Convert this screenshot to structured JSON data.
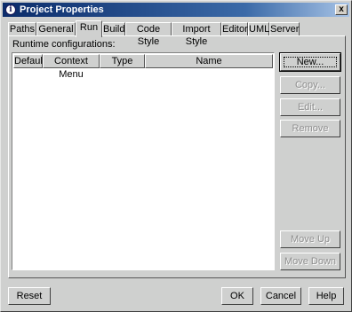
{
  "window": {
    "title": "Project Properties",
    "close_label": "x"
  },
  "tabs": [
    {
      "label": "Paths"
    },
    {
      "label": "General"
    },
    {
      "label": "Run",
      "active": true
    },
    {
      "label": "Build"
    },
    {
      "label": "Code Style"
    },
    {
      "label": "Import Style"
    },
    {
      "label": "Editor"
    },
    {
      "label": "UML"
    },
    {
      "label": "Server"
    }
  ],
  "run": {
    "section_label": "Runtime configurations:",
    "columns": [
      "Default",
      "Context Menu",
      "Type",
      "Name"
    ],
    "rows": []
  },
  "side_buttons": {
    "new": "New...",
    "copy": "Copy...",
    "edit": "Edit...",
    "remove": "Remove",
    "move_up": "Move Up",
    "move_down": "Move Down"
  },
  "bottom_buttons": {
    "reset": "Reset",
    "ok": "OK",
    "cancel": "Cancel",
    "help": "Help"
  }
}
